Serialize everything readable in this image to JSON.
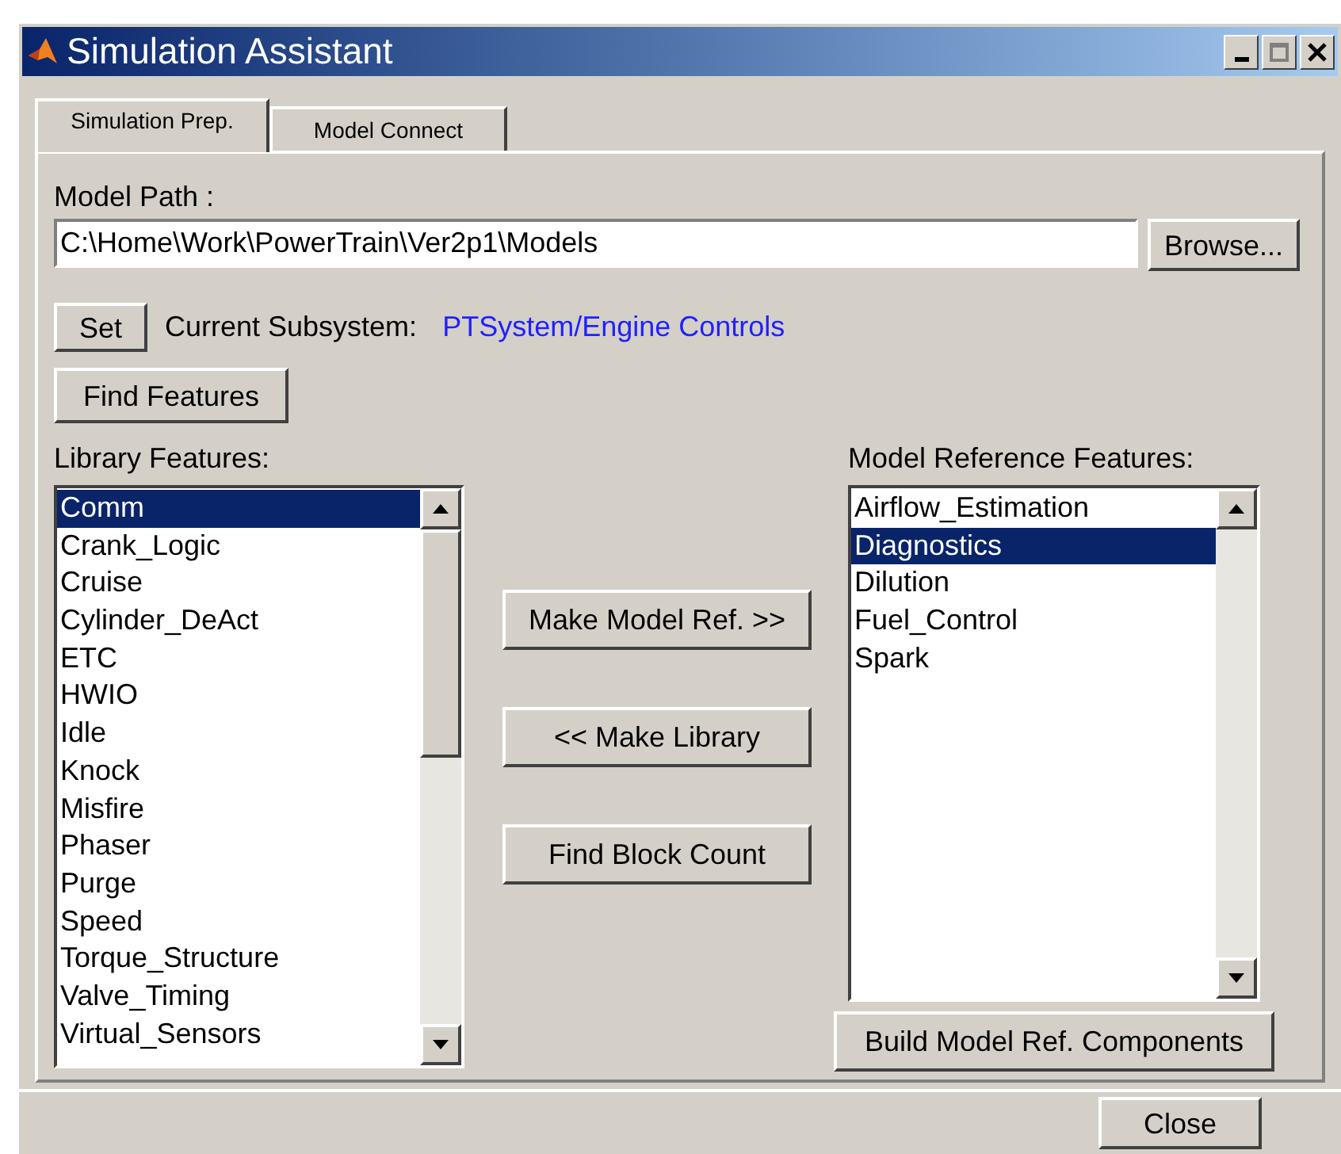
{
  "window": {
    "title": "Simulation Assistant"
  },
  "tabs": [
    {
      "label": "Simulation Prep.",
      "selected": true
    },
    {
      "label": "Model Connect",
      "selected": false
    }
  ],
  "model_path": {
    "label": "Model Path :",
    "value": "C:\\Home\\Work\\PowerTrain\\Ver2p1\\Models",
    "browse_button": "Browse..."
  },
  "subsystem": {
    "set_button": "Set",
    "label": "Current Subsystem:",
    "value": "PTSystem/Engine Controls"
  },
  "find_features_button": "Find Features",
  "library_features": {
    "label": "Library Features:",
    "items": [
      {
        "label": "Comm",
        "selected": true
      },
      {
        "label": "Crank_Logic",
        "selected": false
      },
      {
        "label": "Cruise",
        "selected": false
      },
      {
        "label": "Cylinder_DeAct",
        "selected": false
      },
      {
        "label": "ETC",
        "selected": false
      },
      {
        "label": "HWIO",
        "selected": false
      },
      {
        "label": "Idle",
        "selected": false
      },
      {
        "label": "Knock",
        "selected": false
      },
      {
        "label": "Misfire",
        "selected": false
      },
      {
        "label": "Phaser",
        "selected": false
      },
      {
        "label": "Purge",
        "selected": false
      },
      {
        "label": "Speed",
        "selected": false
      },
      {
        "label": "Torque_Structure",
        "selected": false
      },
      {
        "label": "Valve_Timing",
        "selected": false
      },
      {
        "label": "Virtual_Sensors",
        "selected": false
      }
    ]
  },
  "middle_buttons": [
    "Make Model Ref. >>",
    "<< Make Library",
    "Find Block Count"
  ],
  "model_reference_features": {
    "label": "Model Reference Features:",
    "items": [
      {
        "label": "Airflow_Estimation",
        "selected": false
      },
      {
        "label": "Diagnostics",
        "selected": true
      },
      {
        "label": "Dilution",
        "selected": false
      },
      {
        "label": "Fuel_Control",
        "selected": false
      },
      {
        "label": "Spark",
        "selected": false
      }
    ]
  },
  "build_button": "Build Model Ref. Components",
  "close_button": "Close"
}
